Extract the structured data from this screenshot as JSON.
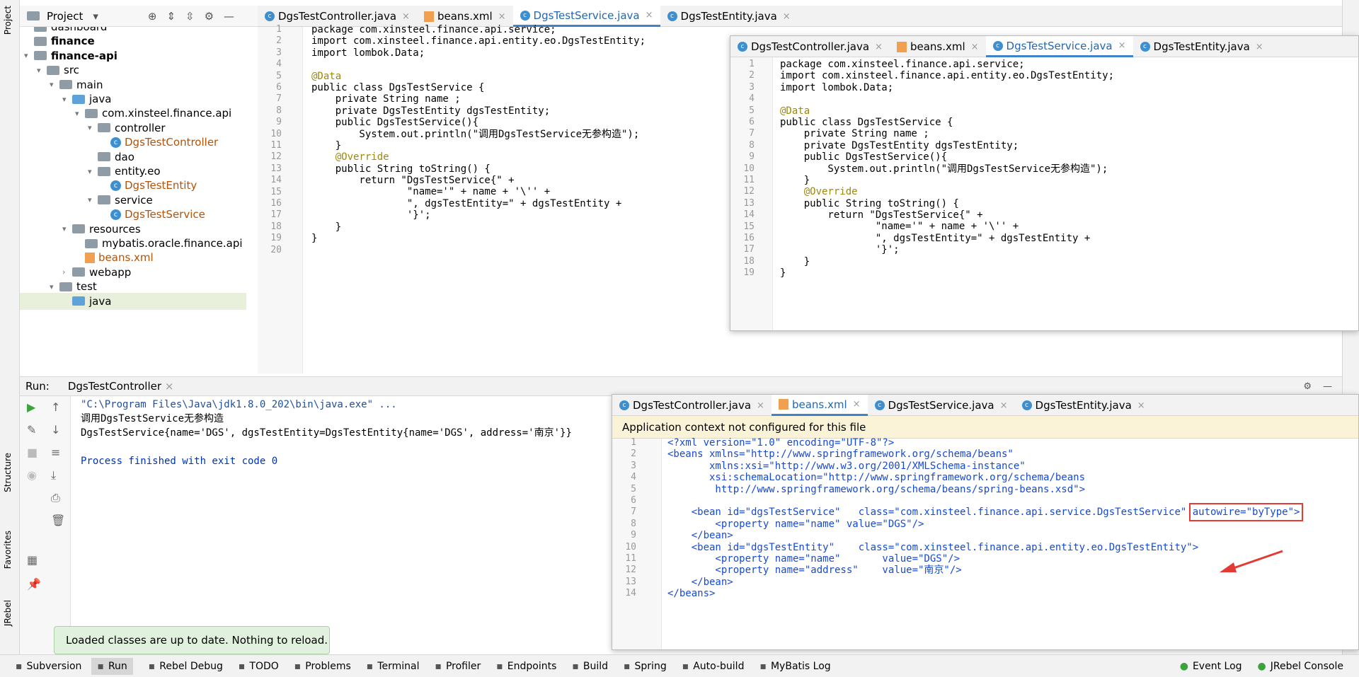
{
  "left_strip": {
    "project_label": "Project",
    "structure_label": "Structure",
    "favorites_label": "Favorites",
    "jrebel_label": "JRebel"
  },
  "project_panel": {
    "title": "Project",
    "tree": [
      {
        "label": "dashboard",
        "type": "folder"
      },
      {
        "label": "finance",
        "type": "module"
      },
      {
        "label": "finance-api",
        "type": "module"
      },
      {
        "label": "src",
        "type": "folder"
      },
      {
        "label": "main",
        "type": "folder"
      },
      {
        "label": "java",
        "type": "source-folder"
      },
      {
        "label": "com.xinsteel.finance.api",
        "type": "package"
      },
      {
        "label": "controller",
        "type": "package"
      },
      {
        "label": "DgsTestController",
        "type": "class"
      },
      {
        "label": "dao",
        "type": "package"
      },
      {
        "label": "entity.eo",
        "type": "package"
      },
      {
        "label": "DgsTestEntity",
        "type": "class"
      },
      {
        "label": "service",
        "type": "package"
      },
      {
        "label": "DgsTestService",
        "type": "class"
      },
      {
        "label": "resources",
        "type": "folder"
      },
      {
        "label": "mybatis.oracle.finance.api",
        "type": "folder"
      },
      {
        "label": "beans.xml",
        "type": "xml"
      },
      {
        "label": "webapp",
        "type": "folder"
      },
      {
        "label": "test",
        "type": "folder"
      },
      {
        "label": "java",
        "type": "source-folder"
      }
    ]
  },
  "editor_tabs": [
    {
      "label": "DgsTestController.java",
      "active": false
    },
    {
      "label": "beans.xml",
      "active": false
    },
    {
      "label": "DgsTestService.java",
      "active": true
    },
    {
      "label": "DgsTestEntity.java",
      "active": false
    }
  ],
  "editor_code": [
    "package com.xinsteel.finance.api.service;",
    "import com.xinsteel.finance.api.entity.eo.DgsTestEntity;",
    "import lombok.Data;",
    "",
    "@Data",
    "public class DgsTestService {",
    "    private String name ;",
    "    private DgsTestEntity dgsTestEntity;",
    "    public DgsTestService(){",
    "        System.out.println(\"调用DgsTestService无参构造\");",
    "    }",
    "    @Override",
    "    public String toString() {",
    "        return \"DgsTestService{\" +",
    "                \"name='\" + name + '\\'' +",
    "                \", dgsTestEntity=\" + dgsTestEntity +",
    "                '}';",
    "    }",
    "}",
    ""
  ],
  "popup1": {
    "tabs": [
      {
        "label": "DgsTestController.java",
        "active": false
      },
      {
        "label": "beans.xml",
        "active": false
      },
      {
        "label": "DgsTestService.java",
        "active": true
      },
      {
        "label": "DgsTestEntity.java",
        "active": false
      }
    ],
    "code": [
      "package com.xinsteel.finance.api.service;",
      "import com.xinsteel.finance.api.entity.eo.DgsTestEntity;",
      "import lombok.Data;",
      "",
      "@Data",
      "public class DgsTestService {",
      "    private String name ;",
      "    private DgsTestEntity dgsTestEntity;",
      "    public DgsTestService(){",
      "        System.out.println(\"调用DgsTestService无参构造\");",
      "    }",
      "    @Override",
      "    public String toString() {",
      "        return \"DgsTestService{\" +",
      "                \"name='\" + name + '\\'' +",
      "                \", dgsTestEntity=\" + dgsTestEntity +",
      "                '}';",
      "    }",
      "}"
    ]
  },
  "popup2": {
    "tabs": [
      {
        "label": "DgsTestController.java",
        "active": false
      },
      {
        "label": "beans.xml",
        "active": true
      },
      {
        "label": "DgsTestService.java",
        "active": false
      },
      {
        "label": "DgsTestEntity.java",
        "active": false
      }
    ],
    "banner": "Application context not configured for this file",
    "code": [
      "<?xml version=\"1.0\" encoding=\"UTF-8\"?>",
      "<beans xmlns=\"http://www.springframework.org/schema/beans\"",
      "       xmlns:xsi=\"http://www.w3.org/2001/XMLSchema-instance\"",
      "       xsi:schemaLocation=\"http://www.springframework.org/schema/beans",
      "        http://www.springframework.org/schema/beans/spring-beans.xsd\">",
      "",
      "    <bean id=\"dgsTestService\"   class=\"com.xinsteel.finance.api.service.DgsTestService\" ",
      "        <property name=\"name\" value=\"DGS\"/>",
      "    </bean>",
      "    <bean id=\"dgsTestEntity\"    class=\"com.xinsteel.finance.api.entity.eo.DgsTestEntity\">",
      "        <property name=\"name\"       value=\"DGS\"/>",
      "        <property name=\"address\"    value=\"南京\"/>",
      "    </bean>",
      "</beans>"
    ],
    "autowire_text": "autowire=\"byType\">"
  },
  "run_panel": {
    "label": "Run:",
    "tab": "DgsTestController",
    "console": [
      "\"C:\\Program Files\\Java\\jdk1.8.0_202\\bin\\java.exe\" ...",
      "调用DgsTestService无参构造",
      "DgsTestService{name='DGS', dgsTestEntity=DgsTestEntity{name='DGS', address='南京'}}",
      "",
      "Process finished with exit code 0"
    ]
  },
  "toast": "Loaded classes are up to date. Nothing to reload.",
  "statusbar": [
    {
      "label": "Subversion",
      "icon": "subversion-icon"
    },
    {
      "label": "Run",
      "icon": "run-icon",
      "active": true
    },
    {
      "label": "Rebel Debug",
      "icon": "rebel-debug-icon"
    },
    {
      "label": "TODO",
      "icon": "todo-icon"
    },
    {
      "label": "Problems",
      "icon": "problems-icon"
    },
    {
      "label": "Terminal",
      "icon": "terminal-icon"
    },
    {
      "label": "Profiler",
      "icon": "profiler-icon"
    },
    {
      "label": "Endpoints",
      "icon": "endpoints-icon"
    },
    {
      "label": "Build",
      "icon": "build-icon"
    },
    {
      "label": "Spring",
      "icon": "spring-icon"
    },
    {
      "label": "Auto-build",
      "icon": "autobuild-icon"
    },
    {
      "label": "MyBatis Log",
      "icon": "mybatis-icon"
    }
  ],
  "statusbar_right": [
    {
      "label": "Event Log",
      "icon": "event-log-icon"
    },
    {
      "label": "JRebel Console",
      "icon": "jrebel-console-icon"
    }
  ],
  "colors": {
    "keyword": "#0033b3",
    "annotation": "#9e880d",
    "string": "#067d17",
    "field": "#871094",
    "highlight": "#e53935"
  }
}
